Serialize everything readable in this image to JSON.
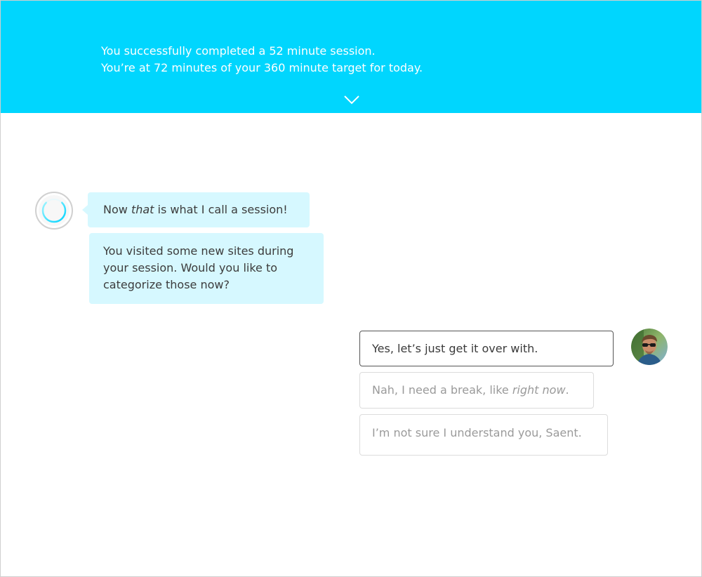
{
  "banner": {
    "line1": "You successfully completed a 52 minute session.",
    "line2": "You’re at 72 minutes of your 360 minute target for today.",
    "chevron_icon": "chevron-down-icon",
    "background_color": "#00d6fe"
  },
  "chat": {
    "bot_avatar_icon": "bot-ring-icon",
    "user_avatar_icon": "user-photo-avatar",
    "bot_messages": [
      {
        "before": "Now ",
        "emphasis": "that",
        "after": " is what I call a session!"
      },
      {
        "text": "You visited some new sites during your session. Would you like to categorize those now?"
      }
    ],
    "bubble_color": "#d6f8ff",
    "reply_options": [
      {
        "text": "Yes, let’s just get it over with.",
        "selected": true
      },
      {
        "before": "Nah, I need a break, like ",
        "emphasis": "right now",
        "after": ".",
        "selected": false
      },
      {
        "text": "I’m not sure I understand you, Saent.",
        "selected": false
      }
    ]
  }
}
